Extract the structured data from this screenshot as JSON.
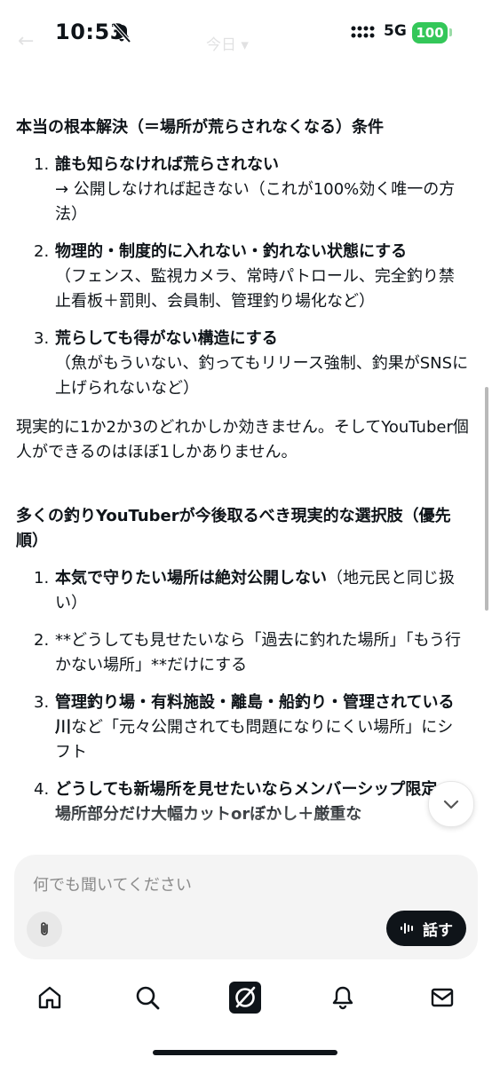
{
  "status_bar": {
    "time": "10:53",
    "network": "5G",
    "battery": "100"
  },
  "ghost_header": {
    "title": "今日 ▾"
  },
  "section1": {
    "heading": "本当の根本解決（＝場所が荒らされなくなる）条件",
    "items": [
      {
        "num": "1.",
        "bold": "誰も知らなければ荒らされない",
        "rest": "→ 公開しなければ起きない（これが100%効く唯一の方法）"
      },
      {
        "num": "2.",
        "bold": "物理的・制度的に入れない・釣れない状態にする",
        "rest": "（フェンス、監視カメラ、常時パトロール、完全釣り禁止看板＋罰則、会員制、管理釣り場化など）"
      },
      {
        "num": "3.",
        "bold": "荒らしても得がない構造にする",
        "rest": "（魚がもういない、釣ってもリリース強制、釣果がSNSに上げられないなど）"
      }
    ],
    "summary": "現実的に1か2か3のどれかしか効きません。そしてYouTuber個人ができるのはほぼ1しかありません。"
  },
  "section2": {
    "heading": "多くの釣りYouTuberが今後取るべき現実的な選択肢（優先順）",
    "items": [
      {
        "num": "1.",
        "bold": "本気で守りたい場所は絶対公開しない",
        "rest": "（地元民と同じ扱い）"
      },
      {
        "num": "2.",
        "bold": "",
        "rest": "**どうしても見せたいなら「過去に釣れた場所」「もう行かない場所」**だけにする"
      },
      {
        "num": "3.",
        "bold": "管理釣り場・有料施設・離島・船釣り・管理されている川",
        "rest": "など「元々公開されても問題になりにくい場所」にシフト"
      },
      {
        "num": "4.",
        "bold": "どうしても新場所を見せたいならメンバーシップ限定＋場所部分だけ大幅カットorぼかし＋厳重な",
        "rest": ""
      }
    ]
  },
  "composer": {
    "placeholder": "何でも聞いてください",
    "talk_label": "話す"
  },
  "colors": {
    "text": "#0f1419",
    "battery": "#34c759",
    "composer_bg": "#f4f4f4"
  }
}
